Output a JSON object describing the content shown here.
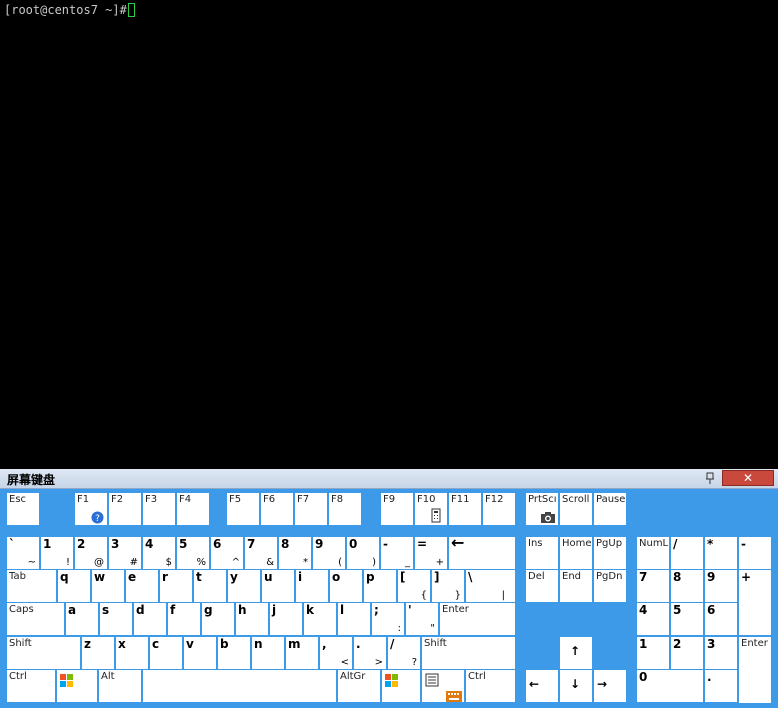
{
  "terminal": {
    "prompt": "[root@centos7 ~]# "
  },
  "osk": {
    "title": "屏幕键盘",
    "close_label": "✕",
    "keys": {
      "esc": "Esc",
      "f1": "F1",
      "f2": "F2",
      "f3": "F3",
      "f4": "F4",
      "f5": "F5",
      "f6": "F6",
      "f7": "F7",
      "f8": "F8",
      "f9": "F9",
      "f10": "F10",
      "f11": "F11",
      "f12": "F12",
      "prtsc": "PrtScı",
      "scroll": "Scroll",
      "pause": "Pause",
      "backtick": "`",
      "backtick_s": "~",
      "k1": "1",
      "k1_s": "!",
      "k2": "2",
      "k2_s": "@",
      "k3": "3",
      "k3_s": "#",
      "k4": "4",
      "k4_s": "$",
      "k5": "5",
      "k5_s": "%",
      "k6": "6",
      "k6_s": "^",
      "k7": "7",
      "k7_s": "&",
      "k8": "8",
      "k8_s": "*",
      "k9": "9",
      "k9_s": "(",
      "k0": "0",
      "k0_s": ")",
      "minus": "-",
      "minus_s": "_",
      "equal": "=",
      "equal_s": "+",
      "backspace": "←",
      "ins": "Ins",
      "home": "Home",
      "pgup": "PgUp",
      "numlock": "NumL",
      "numdiv": "/",
      "nummul": "*",
      "numsub": "-",
      "tab": "Tab",
      "q": "q",
      "w": "w",
      "e": "e",
      "r": "r",
      "t": "t",
      "y": "y",
      "u": "u",
      "i": "i",
      "o": "o",
      "p": "p",
      "lbracket": "[",
      "lbracket_s": "{",
      "rbracket": "]",
      "rbracket_s": "}",
      "backslash": "\\",
      "backslash_s": "|",
      "del": "Del",
      "end": "End",
      "pgdn": "PgDn",
      "num7": "7",
      "num8": "8",
      "num9": "9",
      "numadd": "+",
      "caps": "Caps",
      "a": "a",
      "s": "s",
      "d": "d",
      "f": "f",
      "g": "g",
      "h": "h",
      "j": "j",
      "k": "k",
      "l": "l",
      "semicolon": ";",
      "semicolon_s": ":",
      "quote": "'",
      "quote_s": "\"",
      "enter": "Enter",
      "num4": "4",
      "num5": "5",
      "num6": "6",
      "lshift": "Shift",
      "z": "z",
      "x": "x",
      "c": "c",
      "v": "v",
      "b": "b",
      "n": "n",
      "m": "m",
      "comma": ",",
      "comma_s": "<",
      "period": ".",
      "period_s": ">",
      "slash": "/",
      "slash_s": "?",
      "rshift": "Shift",
      "up": "↑",
      "num1": "1",
      "num2": "2",
      "num3": "3",
      "numenter": "Enter",
      "lctrl": "Ctrl",
      "lalt": "Alt",
      "altgr": "AltGr",
      "rctrl": "Ctrl",
      "left": "←",
      "down": "↓",
      "right": "→",
      "num0": "0",
      "numdot": "."
    }
  },
  "colors": {
    "osk_background": "#3d9ae8",
    "key_face": "#ffffff",
    "cursor": "#2ecc40"
  }
}
